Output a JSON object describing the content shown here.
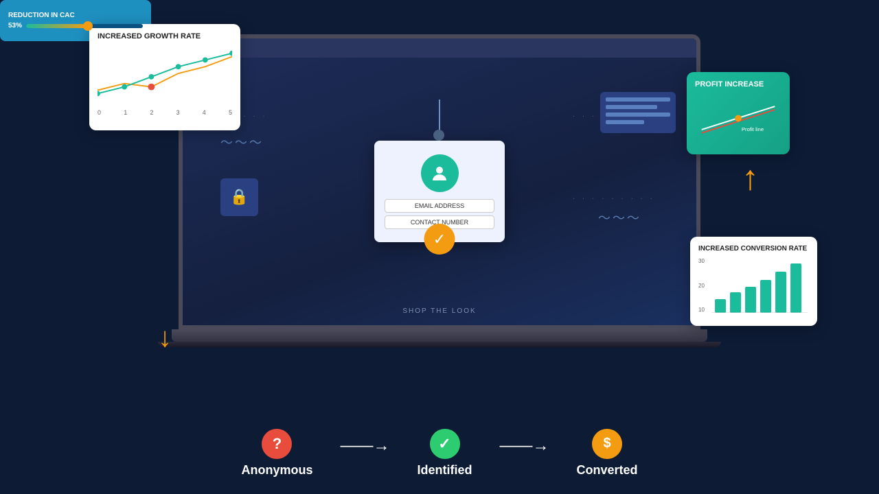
{
  "page": {
    "background": "#0d1b35"
  },
  "growth_card": {
    "title": "INCREASED GROWTH RATE",
    "labels": [
      "0",
      "1",
      "2",
      "3",
      "4",
      "5"
    ]
  },
  "profit_card": {
    "title": "PROFIT INCREASE",
    "subtitle": "Profit line"
  },
  "conversion_card": {
    "title": "INCREASED CONVERSION RATE",
    "y_labels": [
      "10",
      "20",
      "30"
    ]
  },
  "cac_card": {
    "title": "REDUCTION IN CAC",
    "percent": "53%"
  },
  "flow": {
    "step1_label": "Anonymous",
    "step2_label": "Identified",
    "step3_label": "Converted",
    "arrow": "⟶"
  },
  "email_card": {
    "email_field": "EMAIL ADDRESS",
    "contact_field": "CONTACT NUMBER"
  },
  "shop_label": "SHOP THE LOOK"
}
